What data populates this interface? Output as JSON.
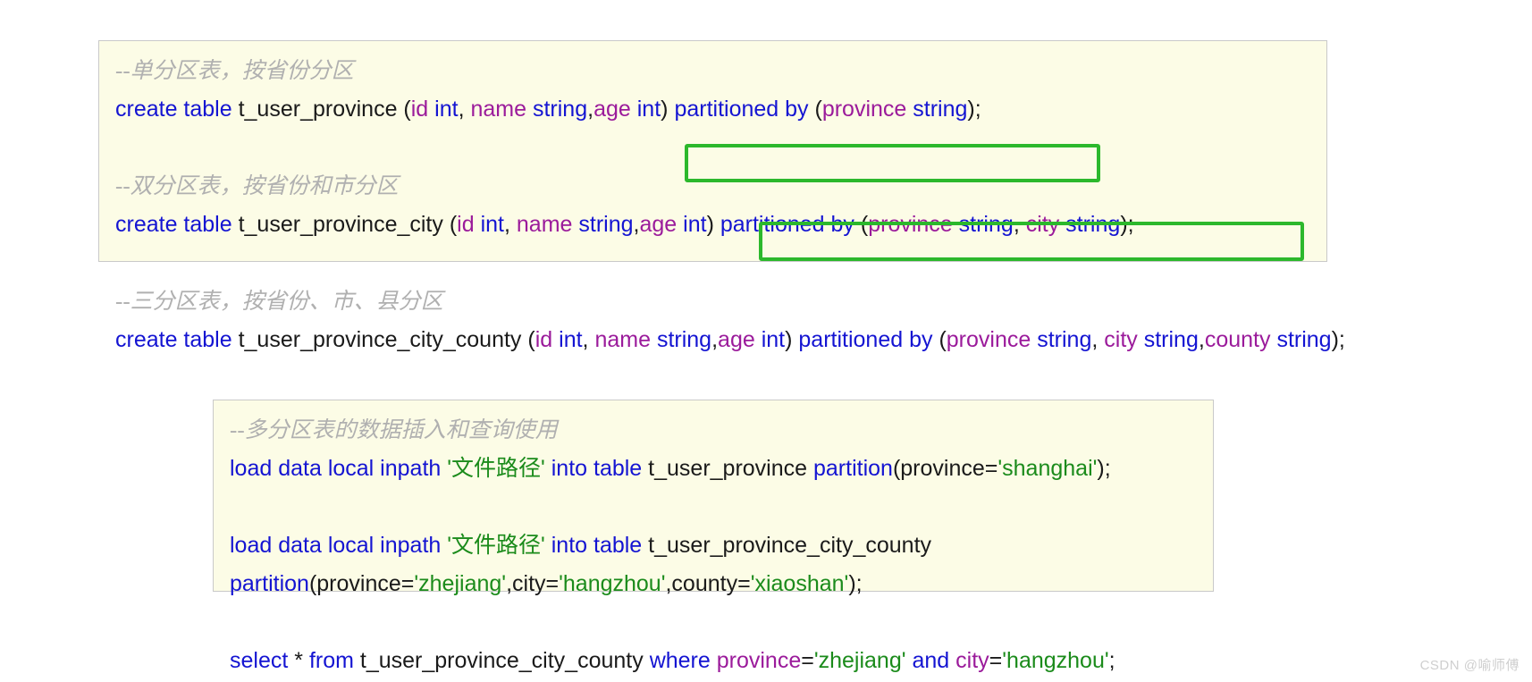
{
  "page": {
    "background": "#ffffff",
    "watermark": "CSDN @喻师傅"
  },
  "colors": {
    "code_background": "#fcfce6",
    "code_border": "#c9c9c9",
    "keyword": "#1414d2",
    "column": "#9b1b9b",
    "string": "#1b8b1b",
    "comment": "#b0b0b0",
    "plain": "#1a1a1a",
    "highlight_box": "#2cb82c"
  },
  "blocks": {
    "create": {
      "comment1": "--单分区表，按省份分区",
      "line1": {
        "kw_create": "create table",
        "table": " t_user_province ",
        "p_open": "(",
        "c_id": "id",
        "t_int1": " int",
        "comma1": ", ",
        "c_name": "name",
        "t_string1": " string",
        "comma2": ",",
        "c_age": "age",
        "t_int2": " int",
        "p_close": ") ",
        "kw_part": "partitioned by",
        "p_open2": " (",
        "c_province": "province",
        "t_string2": " string",
        "tail": ");"
      },
      "comment2": "--双分区表，按省份和市分区",
      "line2": {
        "kw_create": "create table",
        "table": " t_user_province_city ",
        "p_open": "(",
        "c_id": "id",
        "t_int1": " int",
        "comma1": ", ",
        "c_name": "name",
        "t_string1": " string",
        "comma2": ",",
        "c_age": "age",
        "t_int2": " int",
        "p_close": ")",
        "kw_part": " partitioned by",
        "p_open2": " (",
        "c_province": "province",
        "t_string2": " string",
        "comma3": ", ",
        "c_city": "city",
        "t_string3": " string",
        "tail": ");"
      },
      "comment3": "--三分区表，按省份、市、县分区",
      "line3": {
        "kw_create": "create table",
        "table": " t_user_province_city_county ",
        "p_open": "(",
        "c_id": "id",
        "t_int1": " int",
        "comma1": ", ",
        "c_name": "name",
        "t_string1": " string",
        "comma2": ",",
        "c_age": "age",
        "t_int2": " int",
        "p_close": ")",
        "kw_part": " partitioned by",
        "p_open2": " (",
        "c_province": "province",
        "t_string2": " string",
        "comma3": ", ",
        "c_city": "city",
        "t_string3": " string",
        "comma4": ",",
        "c_county": "county",
        "t_string4": " string",
        "tail": ");"
      }
    },
    "dml": {
      "comment1": "--多分区表的数据插入和查询使用",
      "load1": {
        "kw_load": "load data local inpath",
        "path": " '文件路径'",
        "kw_into": " into table",
        "table": " t_user_province ",
        "kw_partition": "partition",
        "args_open": "(province=",
        "val_province": "'shanghai'",
        "tail": ");"
      },
      "load2": {
        "kw_load": "load data local inpath",
        "path": " '文件路径'",
        "kw_into": " into table",
        "table": " t_user_province_city_county",
        "kw_partition": "partition",
        "args_open": "(province=",
        "val_province": "'zhejiang'",
        "sep1": ",city=",
        "val_city": "'hangzhou'",
        "sep2": ",county=",
        "val_county": "'xiaoshan'",
        "tail": ");"
      },
      "select": {
        "kw_select": "select",
        "star": " * ",
        "kw_from": "from",
        "table": " t_user_province_city_county ",
        "kw_where": "where",
        "c_province": " province",
        "eq1": "=",
        "val_province": "'zhejiang'",
        "kw_and": " and",
        "c_city": " city",
        "eq2": "=",
        "val_city": "'hangzhou'",
        "tail": ";"
      }
    }
  },
  "highlights": [
    {
      "name": "two-part-partition-box",
      "label": "partitioned by (province string, city string);"
    },
    {
      "name": "three-part-partition-box",
      "label": "partitioned by (province string, city string,county string);"
    }
  ]
}
